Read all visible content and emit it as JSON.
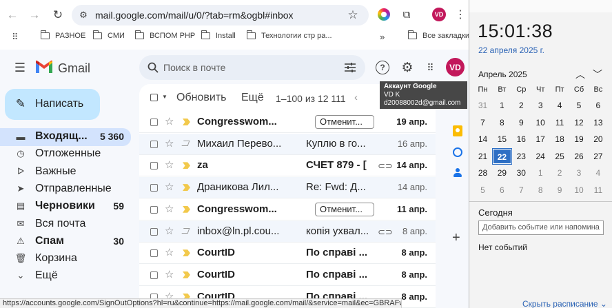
{
  "browser": {
    "url": "mail.google.com/mail/u/0/?tab=rm&ogbl#inbox",
    "profile_initials": "VD",
    "bookmarks": [
      "РАЗНОЕ",
      "СМИ",
      "ВСПОМ PHP",
      "Install",
      "Технологии стр ра..."
    ],
    "bookmarks_more": "»",
    "all_bookmarks": "Все закладки",
    "status_url": "https://accounts.google.com/SignOutOptions?hl=ru&continue=https://mail.google.com/mail/&service=mail&ec=GBRAFw"
  },
  "gmail": {
    "brand": "Gmail",
    "search_placeholder": "Поиск в почте",
    "avatar": "VD",
    "compose": "Написать",
    "toolbar": {
      "refresh": "Обновить",
      "more": "Ещё",
      "range": "1–100 из 12 111"
    },
    "account_tooltip": {
      "title": "Аккаунт Google",
      "name": "VD K",
      "email": "d20088002d@gmail.com"
    },
    "nav": [
      {
        "label": "Входящ...",
        "count": "5 360",
        "icon": "inbox-icon",
        "glyph": "▬",
        "bold": true,
        "active": true
      },
      {
        "label": "Отложенные",
        "count": "",
        "icon": "snoozed-icon",
        "glyph": "◷",
        "bold": false,
        "active": false
      },
      {
        "label": "Важные",
        "count": "",
        "icon": "important-icon",
        "glyph": "ᐅ",
        "bold": false,
        "active": false
      },
      {
        "label": "Отправленные",
        "count": "",
        "icon": "sent-icon",
        "glyph": "➤",
        "bold": false,
        "active": false
      },
      {
        "label": "Черновики",
        "count": "59",
        "icon": "drafts-icon",
        "glyph": "▤",
        "bold": true,
        "active": false
      },
      {
        "label": "Вся почта",
        "count": "",
        "icon": "all-mail-icon",
        "glyph": "✉",
        "bold": false,
        "active": false
      },
      {
        "label": "Спам",
        "count": "30",
        "icon": "spam-icon",
        "glyph": "⚠",
        "bold": true,
        "active": false
      },
      {
        "label": "Корзина",
        "count": "",
        "icon": "trash-icon",
        "glyph": "🗑",
        "bold": false,
        "active": false
      },
      {
        "label": "Ещё",
        "count": "",
        "icon": "more-icon",
        "glyph": "⌄",
        "bold": false,
        "active": false
      }
    ],
    "emails": [
      {
        "sender": "Congresswom...",
        "subject": "",
        "chip": "Отменит...",
        "date": "19 апр.",
        "unread": true,
        "important": true,
        "attach": false
      },
      {
        "sender": "Михаил Перево...",
        "subject": "Куплю в го...",
        "chip": "",
        "date": "16 апр.",
        "unread": false,
        "important": false,
        "attach": false
      },
      {
        "sender": "za",
        "subject": "СЧЕТ 879 - [",
        "chip": "",
        "date": "14 апр.",
        "unread": true,
        "important": true,
        "attach": true
      },
      {
        "sender": "Драникова Лил...",
        "subject": "Re: Fwd: Д...",
        "chip": "",
        "date": "14 апр.",
        "unread": false,
        "important": true,
        "attach": false
      },
      {
        "sender": "Congresswom...",
        "subject": "",
        "chip": "Отменит...",
        "date": "11 апр.",
        "unread": true,
        "important": true,
        "attach": false
      },
      {
        "sender": "inbox@ln.pl.cou...",
        "subject": "копія ухвал...",
        "chip": "",
        "date": "8 апр.",
        "unread": false,
        "important": false,
        "attach": true
      },
      {
        "sender": "CourtID",
        "subject": "По справі ...",
        "chip": "",
        "date": "8 апр.",
        "unread": true,
        "important": true,
        "attach": false
      },
      {
        "sender": "CourtID",
        "subject": "По справі ...",
        "chip": "",
        "date": "8 апр.",
        "unread": true,
        "important": true,
        "attach": false
      },
      {
        "sender": "CourtID",
        "subject": "По справі ...",
        "chip": "",
        "date": "8 апр.",
        "unread": true,
        "important": true,
        "attach": false
      }
    ]
  },
  "calendar": {
    "time": "15:01:38",
    "date": "22 апреля 2025 г.",
    "month": "Апрель 2025",
    "weekdays": [
      "Пн",
      "Вт",
      "Ср",
      "Чт",
      "Пт",
      "Сб",
      "Вс"
    ],
    "weeks": [
      [
        "31",
        "1",
        "2",
        "3",
        "4",
        "5",
        "6"
      ],
      [
        "7",
        "8",
        "9",
        "10",
        "11",
        "12",
        "13"
      ],
      [
        "14",
        "15",
        "16",
        "17",
        "18",
        "19",
        "20"
      ],
      [
        "21",
        "22",
        "23",
        "24",
        "25",
        "26",
        "27"
      ],
      [
        "28",
        "29",
        "30",
        "1",
        "2",
        "3",
        "4"
      ],
      [
        "5",
        "6",
        "7",
        "8",
        "9",
        "10",
        "11"
      ]
    ],
    "today_label": "Сегодня",
    "add_event_placeholder": "Добавить событие или напомина",
    "no_events": "Нет событий",
    "hide_schedule": "Скрыть расписание"
  },
  "colors": {
    "accent": "#0b57d0",
    "compose_bg": "#c2e7ff",
    "important": "#f2c94c",
    "avatar": "#c2185b",
    "today": "#2e6fc4"
  }
}
